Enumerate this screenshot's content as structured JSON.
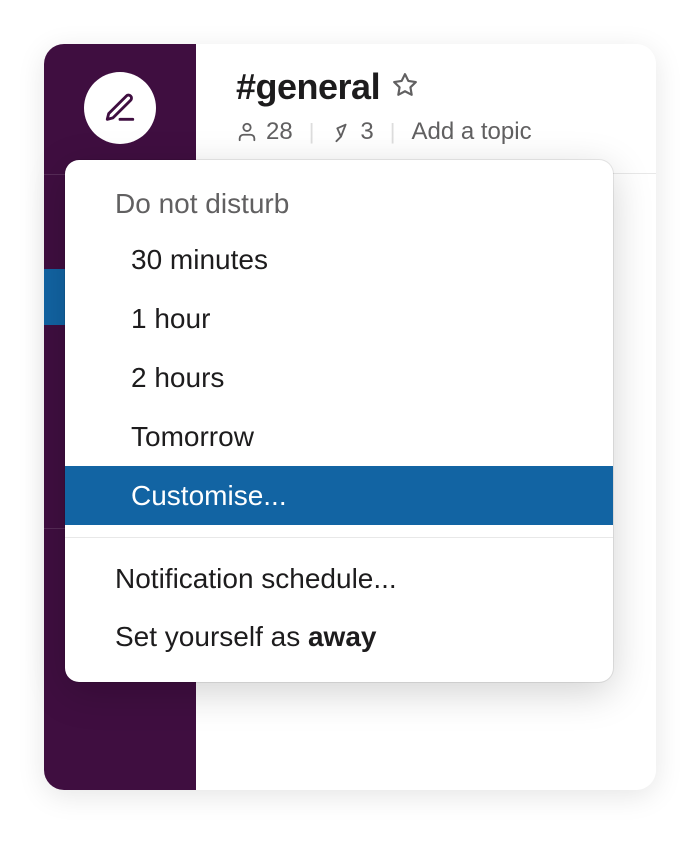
{
  "channel": {
    "name": "#general",
    "members": "28",
    "pinned": "3",
    "topic_placeholder": "Add a topic"
  },
  "menu": {
    "dnd_heading": "Do not disturb",
    "options": {
      "thirty_min": "30 minutes",
      "one_hour": "1 hour",
      "two_hours": "2 hours",
      "tomorrow": "Tomorrow",
      "customise": "Customise..."
    },
    "notification_schedule": "Notification schedule...",
    "set_away_prefix": "Set yourself as ",
    "set_away_bold": "away"
  },
  "colors": {
    "sidebar_bg": "#3F0E40",
    "highlight": "#1264A3"
  }
}
